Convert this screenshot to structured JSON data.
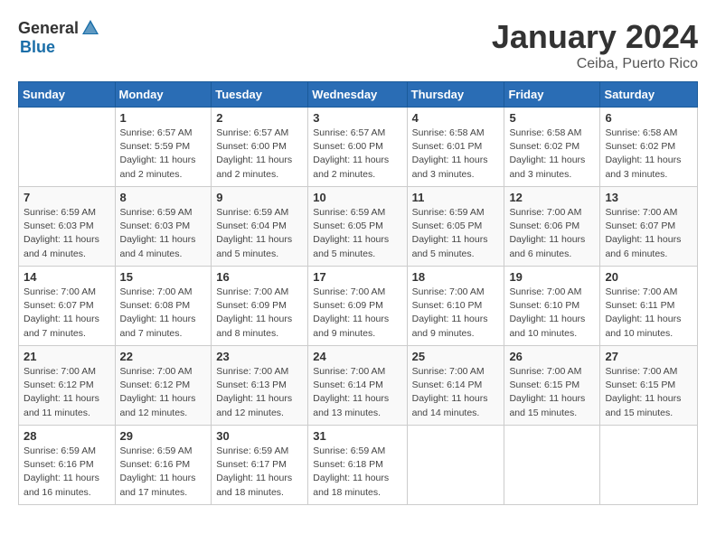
{
  "header": {
    "logo_general": "General",
    "logo_blue": "Blue",
    "month_year": "January 2024",
    "location": "Ceiba, Puerto Rico"
  },
  "weekdays": [
    "Sunday",
    "Monday",
    "Tuesday",
    "Wednesday",
    "Thursday",
    "Friday",
    "Saturday"
  ],
  "weeks": [
    [
      {
        "day": "",
        "sunrise": "",
        "sunset": "",
        "daylight": ""
      },
      {
        "day": "1",
        "sunrise": "Sunrise: 6:57 AM",
        "sunset": "Sunset: 5:59 PM",
        "daylight": "Daylight: 11 hours and 2 minutes."
      },
      {
        "day": "2",
        "sunrise": "Sunrise: 6:57 AM",
        "sunset": "Sunset: 6:00 PM",
        "daylight": "Daylight: 11 hours and 2 minutes."
      },
      {
        "day": "3",
        "sunrise": "Sunrise: 6:57 AM",
        "sunset": "Sunset: 6:00 PM",
        "daylight": "Daylight: 11 hours and 2 minutes."
      },
      {
        "day": "4",
        "sunrise": "Sunrise: 6:58 AM",
        "sunset": "Sunset: 6:01 PM",
        "daylight": "Daylight: 11 hours and 3 minutes."
      },
      {
        "day": "5",
        "sunrise": "Sunrise: 6:58 AM",
        "sunset": "Sunset: 6:02 PM",
        "daylight": "Daylight: 11 hours and 3 minutes."
      },
      {
        "day": "6",
        "sunrise": "Sunrise: 6:58 AM",
        "sunset": "Sunset: 6:02 PM",
        "daylight": "Daylight: 11 hours and 3 minutes."
      }
    ],
    [
      {
        "day": "7",
        "sunrise": "Sunrise: 6:59 AM",
        "sunset": "Sunset: 6:03 PM",
        "daylight": "Daylight: 11 hours and 4 minutes."
      },
      {
        "day": "8",
        "sunrise": "Sunrise: 6:59 AM",
        "sunset": "Sunset: 6:03 PM",
        "daylight": "Daylight: 11 hours and 4 minutes."
      },
      {
        "day": "9",
        "sunrise": "Sunrise: 6:59 AM",
        "sunset": "Sunset: 6:04 PM",
        "daylight": "Daylight: 11 hours and 5 minutes."
      },
      {
        "day": "10",
        "sunrise": "Sunrise: 6:59 AM",
        "sunset": "Sunset: 6:05 PM",
        "daylight": "Daylight: 11 hours and 5 minutes."
      },
      {
        "day": "11",
        "sunrise": "Sunrise: 6:59 AM",
        "sunset": "Sunset: 6:05 PM",
        "daylight": "Daylight: 11 hours and 5 minutes."
      },
      {
        "day": "12",
        "sunrise": "Sunrise: 7:00 AM",
        "sunset": "Sunset: 6:06 PM",
        "daylight": "Daylight: 11 hours and 6 minutes."
      },
      {
        "day": "13",
        "sunrise": "Sunrise: 7:00 AM",
        "sunset": "Sunset: 6:07 PM",
        "daylight": "Daylight: 11 hours and 6 minutes."
      }
    ],
    [
      {
        "day": "14",
        "sunrise": "Sunrise: 7:00 AM",
        "sunset": "Sunset: 6:07 PM",
        "daylight": "Daylight: 11 hours and 7 minutes."
      },
      {
        "day": "15",
        "sunrise": "Sunrise: 7:00 AM",
        "sunset": "Sunset: 6:08 PM",
        "daylight": "Daylight: 11 hours and 7 minutes."
      },
      {
        "day": "16",
        "sunrise": "Sunrise: 7:00 AM",
        "sunset": "Sunset: 6:09 PM",
        "daylight": "Daylight: 11 hours and 8 minutes."
      },
      {
        "day": "17",
        "sunrise": "Sunrise: 7:00 AM",
        "sunset": "Sunset: 6:09 PM",
        "daylight": "Daylight: 11 hours and 9 minutes."
      },
      {
        "day": "18",
        "sunrise": "Sunrise: 7:00 AM",
        "sunset": "Sunset: 6:10 PM",
        "daylight": "Daylight: 11 hours and 9 minutes."
      },
      {
        "day": "19",
        "sunrise": "Sunrise: 7:00 AM",
        "sunset": "Sunset: 6:10 PM",
        "daylight": "Daylight: 11 hours and 10 minutes."
      },
      {
        "day": "20",
        "sunrise": "Sunrise: 7:00 AM",
        "sunset": "Sunset: 6:11 PM",
        "daylight": "Daylight: 11 hours and 10 minutes."
      }
    ],
    [
      {
        "day": "21",
        "sunrise": "Sunrise: 7:00 AM",
        "sunset": "Sunset: 6:12 PM",
        "daylight": "Daylight: 11 hours and 11 minutes."
      },
      {
        "day": "22",
        "sunrise": "Sunrise: 7:00 AM",
        "sunset": "Sunset: 6:12 PM",
        "daylight": "Daylight: 11 hours and 12 minutes."
      },
      {
        "day": "23",
        "sunrise": "Sunrise: 7:00 AM",
        "sunset": "Sunset: 6:13 PM",
        "daylight": "Daylight: 11 hours and 12 minutes."
      },
      {
        "day": "24",
        "sunrise": "Sunrise: 7:00 AM",
        "sunset": "Sunset: 6:14 PM",
        "daylight": "Daylight: 11 hours and 13 minutes."
      },
      {
        "day": "25",
        "sunrise": "Sunrise: 7:00 AM",
        "sunset": "Sunset: 6:14 PM",
        "daylight": "Daylight: 11 hours and 14 minutes."
      },
      {
        "day": "26",
        "sunrise": "Sunrise: 7:00 AM",
        "sunset": "Sunset: 6:15 PM",
        "daylight": "Daylight: 11 hours and 15 minutes."
      },
      {
        "day": "27",
        "sunrise": "Sunrise: 7:00 AM",
        "sunset": "Sunset: 6:15 PM",
        "daylight": "Daylight: 11 hours and 15 minutes."
      }
    ],
    [
      {
        "day": "28",
        "sunrise": "Sunrise: 6:59 AM",
        "sunset": "Sunset: 6:16 PM",
        "daylight": "Daylight: 11 hours and 16 minutes."
      },
      {
        "day": "29",
        "sunrise": "Sunrise: 6:59 AM",
        "sunset": "Sunset: 6:16 PM",
        "daylight": "Daylight: 11 hours and 17 minutes."
      },
      {
        "day": "30",
        "sunrise": "Sunrise: 6:59 AM",
        "sunset": "Sunset: 6:17 PM",
        "daylight": "Daylight: 11 hours and 18 minutes."
      },
      {
        "day": "31",
        "sunrise": "Sunrise: 6:59 AM",
        "sunset": "Sunset: 6:18 PM",
        "daylight": "Daylight: 11 hours and 18 minutes."
      },
      {
        "day": "",
        "sunrise": "",
        "sunset": "",
        "daylight": ""
      },
      {
        "day": "",
        "sunrise": "",
        "sunset": "",
        "daylight": ""
      },
      {
        "day": "",
        "sunrise": "",
        "sunset": "",
        "daylight": ""
      }
    ]
  ]
}
